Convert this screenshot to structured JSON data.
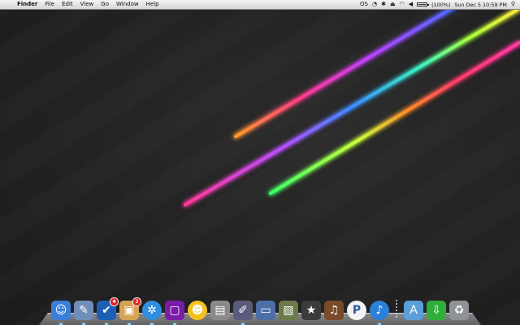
{
  "menubar": {
    "apple_symbol": "",
    "items": [
      {
        "label": "Finder",
        "bold": true
      },
      {
        "label": "File"
      },
      {
        "label": "Edit"
      },
      {
        "label": "View"
      },
      {
        "label": "Go"
      },
      {
        "label": "Window"
      },
      {
        "label": "Help"
      }
    ],
    "status": {
      "sync_label": "OS",
      "battery_text": "(100%)",
      "datetime": "Sun Dec 5  10:59 PM"
    }
  },
  "colors": {
    "menubar_bg": "#e6e6e6",
    "desktop_bg": "#252525"
  },
  "dock": {
    "items": [
      {
        "name": "finder",
        "icon": "finder-icon",
        "glyph": "☺",
        "bg": "#3a7ed8",
        "running": true
      },
      {
        "name": "preview",
        "icon": "preview-icon",
        "glyph": "✎",
        "bg": "#6f8fb8",
        "running": true
      },
      {
        "name": "mail",
        "icon": "mail-icon",
        "glyph": "✔",
        "bg": "#1d5fb3",
        "running": true,
        "badge": "4"
      },
      {
        "name": "package",
        "icon": "package-icon",
        "glyph": "▣",
        "bg": "#d6a455",
        "running": true,
        "badge": "2"
      },
      {
        "name": "safari",
        "icon": "safari-icon",
        "glyph": "✲",
        "bg": "#2f8ee0",
        "running": true
      },
      {
        "name": "screen",
        "icon": "purple-screen-icon",
        "glyph": "▢",
        "bg": "#7a1ca8",
        "running": true
      },
      {
        "name": "messenger",
        "icon": "smiley-icon",
        "glyph": "☻",
        "bg": "#f3c21c",
        "running": false
      },
      {
        "name": "utility",
        "icon": "server-icon",
        "glyph": "▤",
        "bg": "#8a8a8a",
        "running": false
      },
      {
        "name": "paint",
        "icon": "brush-icon",
        "glyph": "✐",
        "bg": "#5a5a7a",
        "running": true
      },
      {
        "name": "presenter",
        "icon": "keynote-icon",
        "glyph": "▭",
        "bg": "#4d6fa8",
        "running": false
      },
      {
        "name": "photos",
        "icon": "iphoto-icon",
        "glyph": "▧",
        "bg": "#6b7b4a",
        "running": false
      },
      {
        "name": "imovie",
        "icon": "imovie-star-icon",
        "glyph": "★",
        "bg": "#3b3b3b",
        "running": false
      },
      {
        "name": "garageband",
        "icon": "guitar-icon",
        "glyph": "♫",
        "bg": "#7a4a2a",
        "running": false
      },
      {
        "name": "pandora",
        "icon": "pandora-icon",
        "glyph": "P",
        "bg": "#f2f2f2",
        "running": false
      },
      {
        "name": "itunes",
        "icon": "itunes-icon",
        "glyph": "♪",
        "bg": "#2a7fd8",
        "running": true
      }
    ],
    "stacks": [
      {
        "name": "applications",
        "icon": "applications-folder-icon",
        "glyph": "A",
        "bg": "#5b9fd8"
      },
      {
        "name": "downloads",
        "icon": "download-file-icon",
        "glyph": "⇩",
        "bg": "#2fae3c"
      },
      {
        "name": "trash",
        "icon": "trash-icon",
        "glyph": "♻",
        "bg": "#8f9398"
      }
    ]
  }
}
